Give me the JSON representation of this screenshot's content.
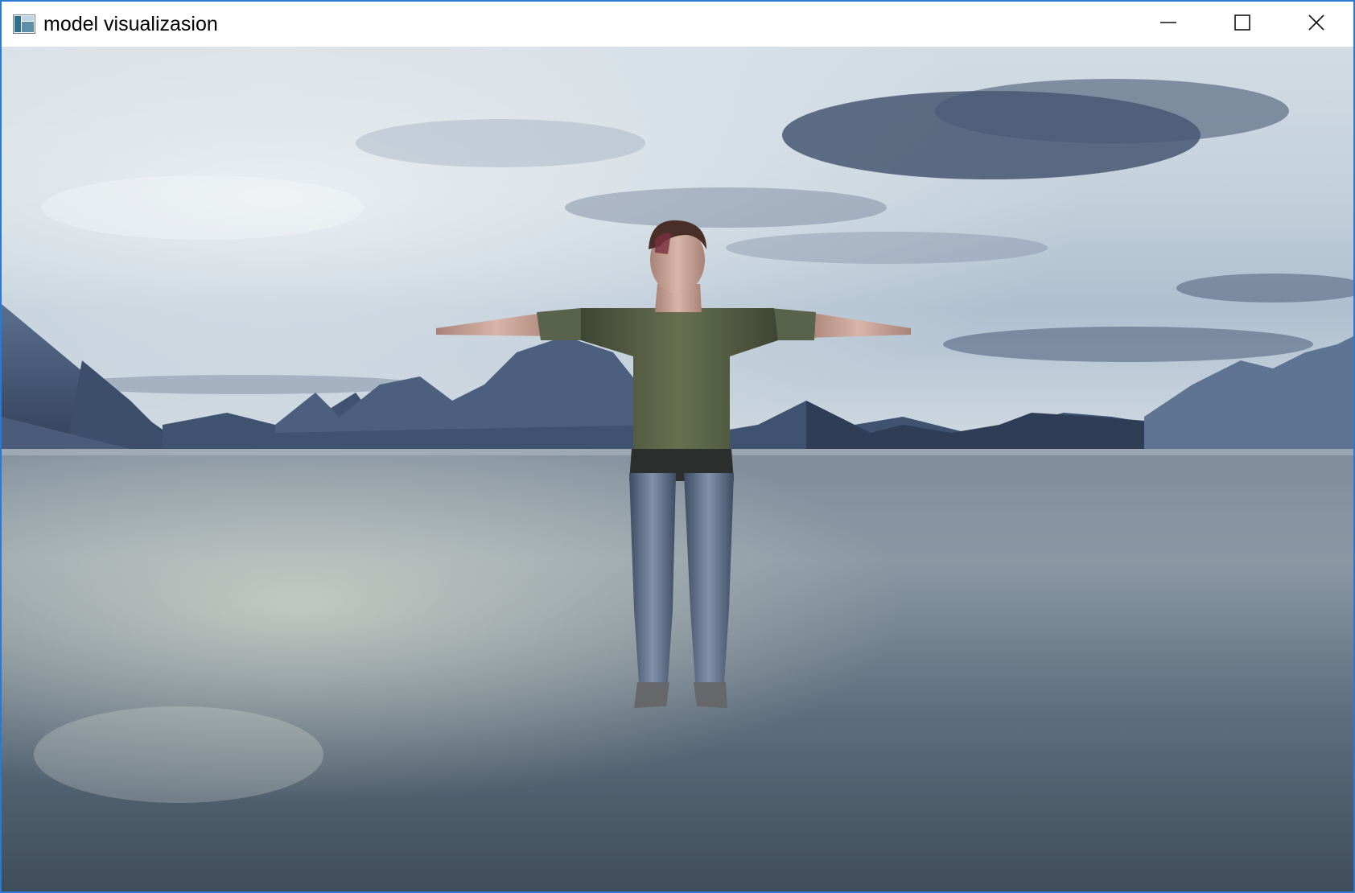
{
  "window": {
    "title": "model visualizasion",
    "app_icon": "app-window-icon",
    "controls": {
      "minimize_icon": "minimize-icon",
      "maximize_icon": "maximize-icon",
      "close_icon": "close-icon"
    },
    "border_color": "#2b79d0"
  },
  "scene": {
    "sky_color": "#b9c9d6",
    "cloud_dark_color": "#3e4e6a",
    "mountain_color": "#4a5c7a",
    "water_color": "#5e7184",
    "figure": {
      "pose": "T-pose",
      "shirt_color": "#59624a",
      "legs_color": "#5b6a83",
      "hair_color": "#4a2e28",
      "skin_color": "#c9a394"
    }
  }
}
